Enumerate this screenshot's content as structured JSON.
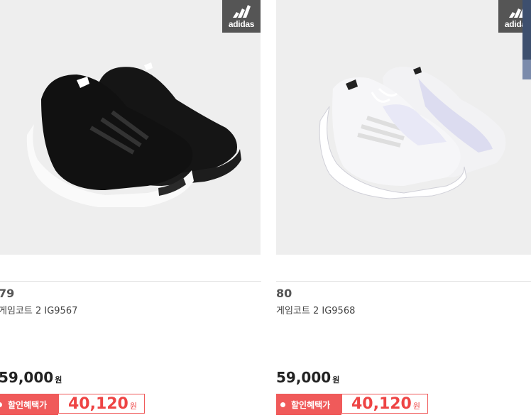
{
  "products": [
    {
      "number": "79",
      "name": "게임코트 2 IG9567",
      "price": "59,000",
      "currency": "원",
      "discount_label": "할인혜택가",
      "discount_price": "40,120",
      "brand_logo": "adidas",
      "shoe_color": "black"
    },
    {
      "number": "80",
      "name": "게임코트 2 IG9568",
      "price": "59,000",
      "currency": "원",
      "discount_label": "할인혜택가",
      "discount_price": "40,120",
      "brand_logo": "adidas",
      "shoe_color": "white"
    }
  ],
  "colors": {
    "discount_accent": "#f05a5a",
    "photo_bg": "#eeeeee"
  }
}
